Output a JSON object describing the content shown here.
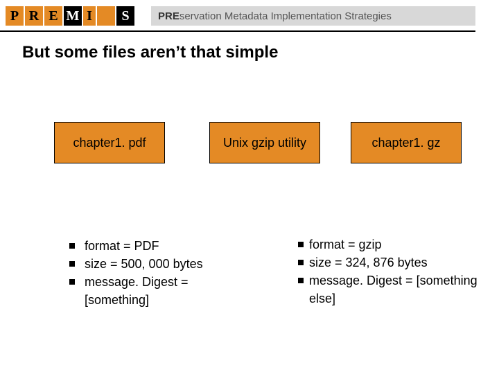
{
  "header": {
    "logo_letters": [
      "P",
      "R",
      "E",
      "M",
      "I",
      "",
      "S"
    ],
    "tagline_strong": "PRE",
    "tagline_rest": "servation Metadata Implementation Strategies"
  },
  "title": "But some files aren’t that simple",
  "boxes": {
    "left": "chapter1. pdf",
    "middle": "Unix gzip utility",
    "right": "chapter1. gz"
  },
  "left_list": {
    "i0": "format = PDF",
    "i1": "size = 500, 000 bytes",
    "i2": "message. Digest = [something]"
  },
  "right_list": {
    "i0": "format = gzip",
    "i1": "size = 324, 876 bytes",
    "i2": "message. Digest = [something else]"
  }
}
